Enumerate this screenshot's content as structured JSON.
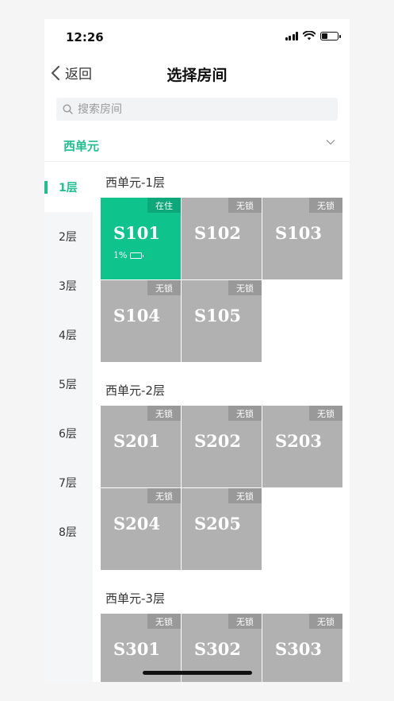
{
  "status_bar": {
    "time": "12:26"
  },
  "nav": {
    "back_label": "返回",
    "title": "选择房间"
  },
  "search": {
    "placeholder": "搜索房间"
  },
  "unit_selector": {
    "label": "西单元"
  },
  "floors": [
    "1层",
    "2层",
    "3层",
    "4层",
    "5层",
    "6层",
    "7层",
    "8层"
  ],
  "active_floor": "1层",
  "sections": [
    {
      "title": "西单元-1层",
      "rooms": [
        {
          "name": "S101",
          "status": "在住",
          "power": "1%"
        },
        {
          "name": "S102",
          "status": "无锁"
        },
        {
          "name": "S103",
          "status": "无锁"
        },
        {
          "name": "S104",
          "status": "无锁"
        },
        {
          "name": "S105",
          "status": "无锁"
        }
      ]
    },
    {
      "title": "西单元-2层",
      "rooms": [
        {
          "name": "S201",
          "status": "无锁"
        },
        {
          "name": "S202",
          "status": "无锁"
        },
        {
          "name": "S203",
          "status": "无锁"
        },
        {
          "name": "S204",
          "status": "无锁"
        },
        {
          "name": "S205",
          "status": "无锁"
        }
      ]
    },
    {
      "title": "西单元-3层",
      "rooms": [
        {
          "name": "S301",
          "status": "无锁"
        },
        {
          "name": "S302",
          "status": "无锁"
        },
        {
          "name": "S303",
          "status": "无锁"
        }
      ]
    }
  ],
  "colors": {
    "accent": "#1fbf8f",
    "occupied_room": "#0fc38d",
    "unlocked_room": "#b1b1b1",
    "badge": "#999999"
  }
}
